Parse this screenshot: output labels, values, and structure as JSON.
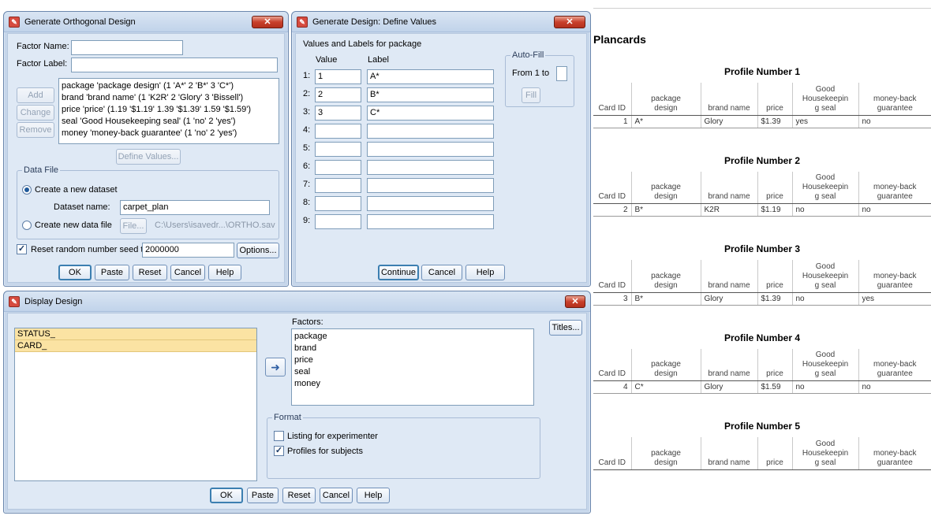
{
  "orthogonal": {
    "title": "Generate Orthogonal Design",
    "close": "✕",
    "factor_name_label": "Factor Name:",
    "factor_label_label": "Factor Label:",
    "factor_name_value": "",
    "factor_label_value": "",
    "add": "Add",
    "change": "Change",
    "remove": "Remove",
    "factors": [
      "package 'package design' (1 'A*' 2 'B*' 3 'C*')",
      "brand 'brand name' (1 'K2R' 2 'Glory' 3 'Bissell')",
      "price 'price' (1.19 '$1.19' 1.39 '$1.39' 1.59 '$1.59')",
      "seal 'Good Housekeeping seal' (1 'no' 2 'yes')",
      "money 'money-back guarantee' (1 'no' 2 'yes')"
    ],
    "define_values": "Define Values...",
    "data_file_group": "Data File",
    "create_dataset": "Create a new dataset",
    "dataset_name_label": "Dataset name:",
    "dataset_name_value": "carpet_plan",
    "create_file": "Create new data file",
    "file_btn": "File...",
    "file_path": "C:\\Users\\isavedr...\\ORTHO.sav",
    "reset_seed": "Reset random number seed to",
    "seed_value": "2000000",
    "options": "Options...",
    "ok": "OK",
    "paste": "Paste",
    "reset": "Reset",
    "cancel": "Cancel",
    "help": "Help"
  },
  "define": {
    "title": "Generate Design: Define Values",
    "close": "✕",
    "heading": "Values and Labels for package",
    "col_value": "Value",
    "col_label": "Label",
    "rows": [
      {
        "n": "1:",
        "value": "1",
        "label": "A*"
      },
      {
        "n": "2:",
        "value": "2",
        "label": "B*"
      },
      {
        "n": "3:",
        "value": "3",
        "label": "C*"
      },
      {
        "n": "4:",
        "value": "",
        "label": ""
      },
      {
        "n": "5:",
        "value": "",
        "label": ""
      },
      {
        "n": "6:",
        "value": "",
        "label": ""
      },
      {
        "n": "7:",
        "value": "",
        "label": ""
      },
      {
        "n": "8:",
        "value": "",
        "label": ""
      },
      {
        "n": "9:",
        "value": "",
        "label": ""
      }
    ],
    "autofill": "Auto-Fill",
    "from_label": "From 1 to",
    "fill": "Fill",
    "continue": "Continue",
    "cancel": "Cancel",
    "help": "Help"
  },
  "display": {
    "title": "Display Design",
    "close": "✕",
    "source": [
      "STATUS_",
      "CARD_"
    ],
    "factors_label": "Factors:",
    "factors": [
      "package",
      "brand",
      "price",
      "seal",
      "money"
    ],
    "titles": "Titles...",
    "format_group": "Format",
    "listing": "Listing for experimenter",
    "profiles": "Profiles for subjects",
    "ok": "OK",
    "paste": "Paste",
    "reset": "Reset",
    "cancel": "Cancel",
    "help": "Help"
  },
  "plancards": {
    "title": "Plancards",
    "headers": [
      "Card ID",
      "package\ndesign",
      "brand name",
      "price",
      "Good\nHousekeepin\ng seal",
      "money-back\nguarantee"
    ],
    "profiles": [
      {
        "heading": "Profile Number 1",
        "row": [
          "1",
          "A*",
          "Glory",
          "$1.39",
          "yes",
          "no"
        ]
      },
      {
        "heading": "Profile Number 2",
        "row": [
          "2",
          "B*",
          "K2R",
          "$1.19",
          "no",
          "no"
        ]
      },
      {
        "heading": "Profile Number 3",
        "row": [
          "3",
          "B*",
          "Glory",
          "$1.39",
          "no",
          "yes"
        ]
      },
      {
        "heading": "Profile Number 4",
        "row": [
          "4",
          "C*",
          "Glory",
          "$1.59",
          "no",
          "no"
        ]
      },
      {
        "heading": "Profile Number 5",
        "row": []
      }
    ]
  }
}
